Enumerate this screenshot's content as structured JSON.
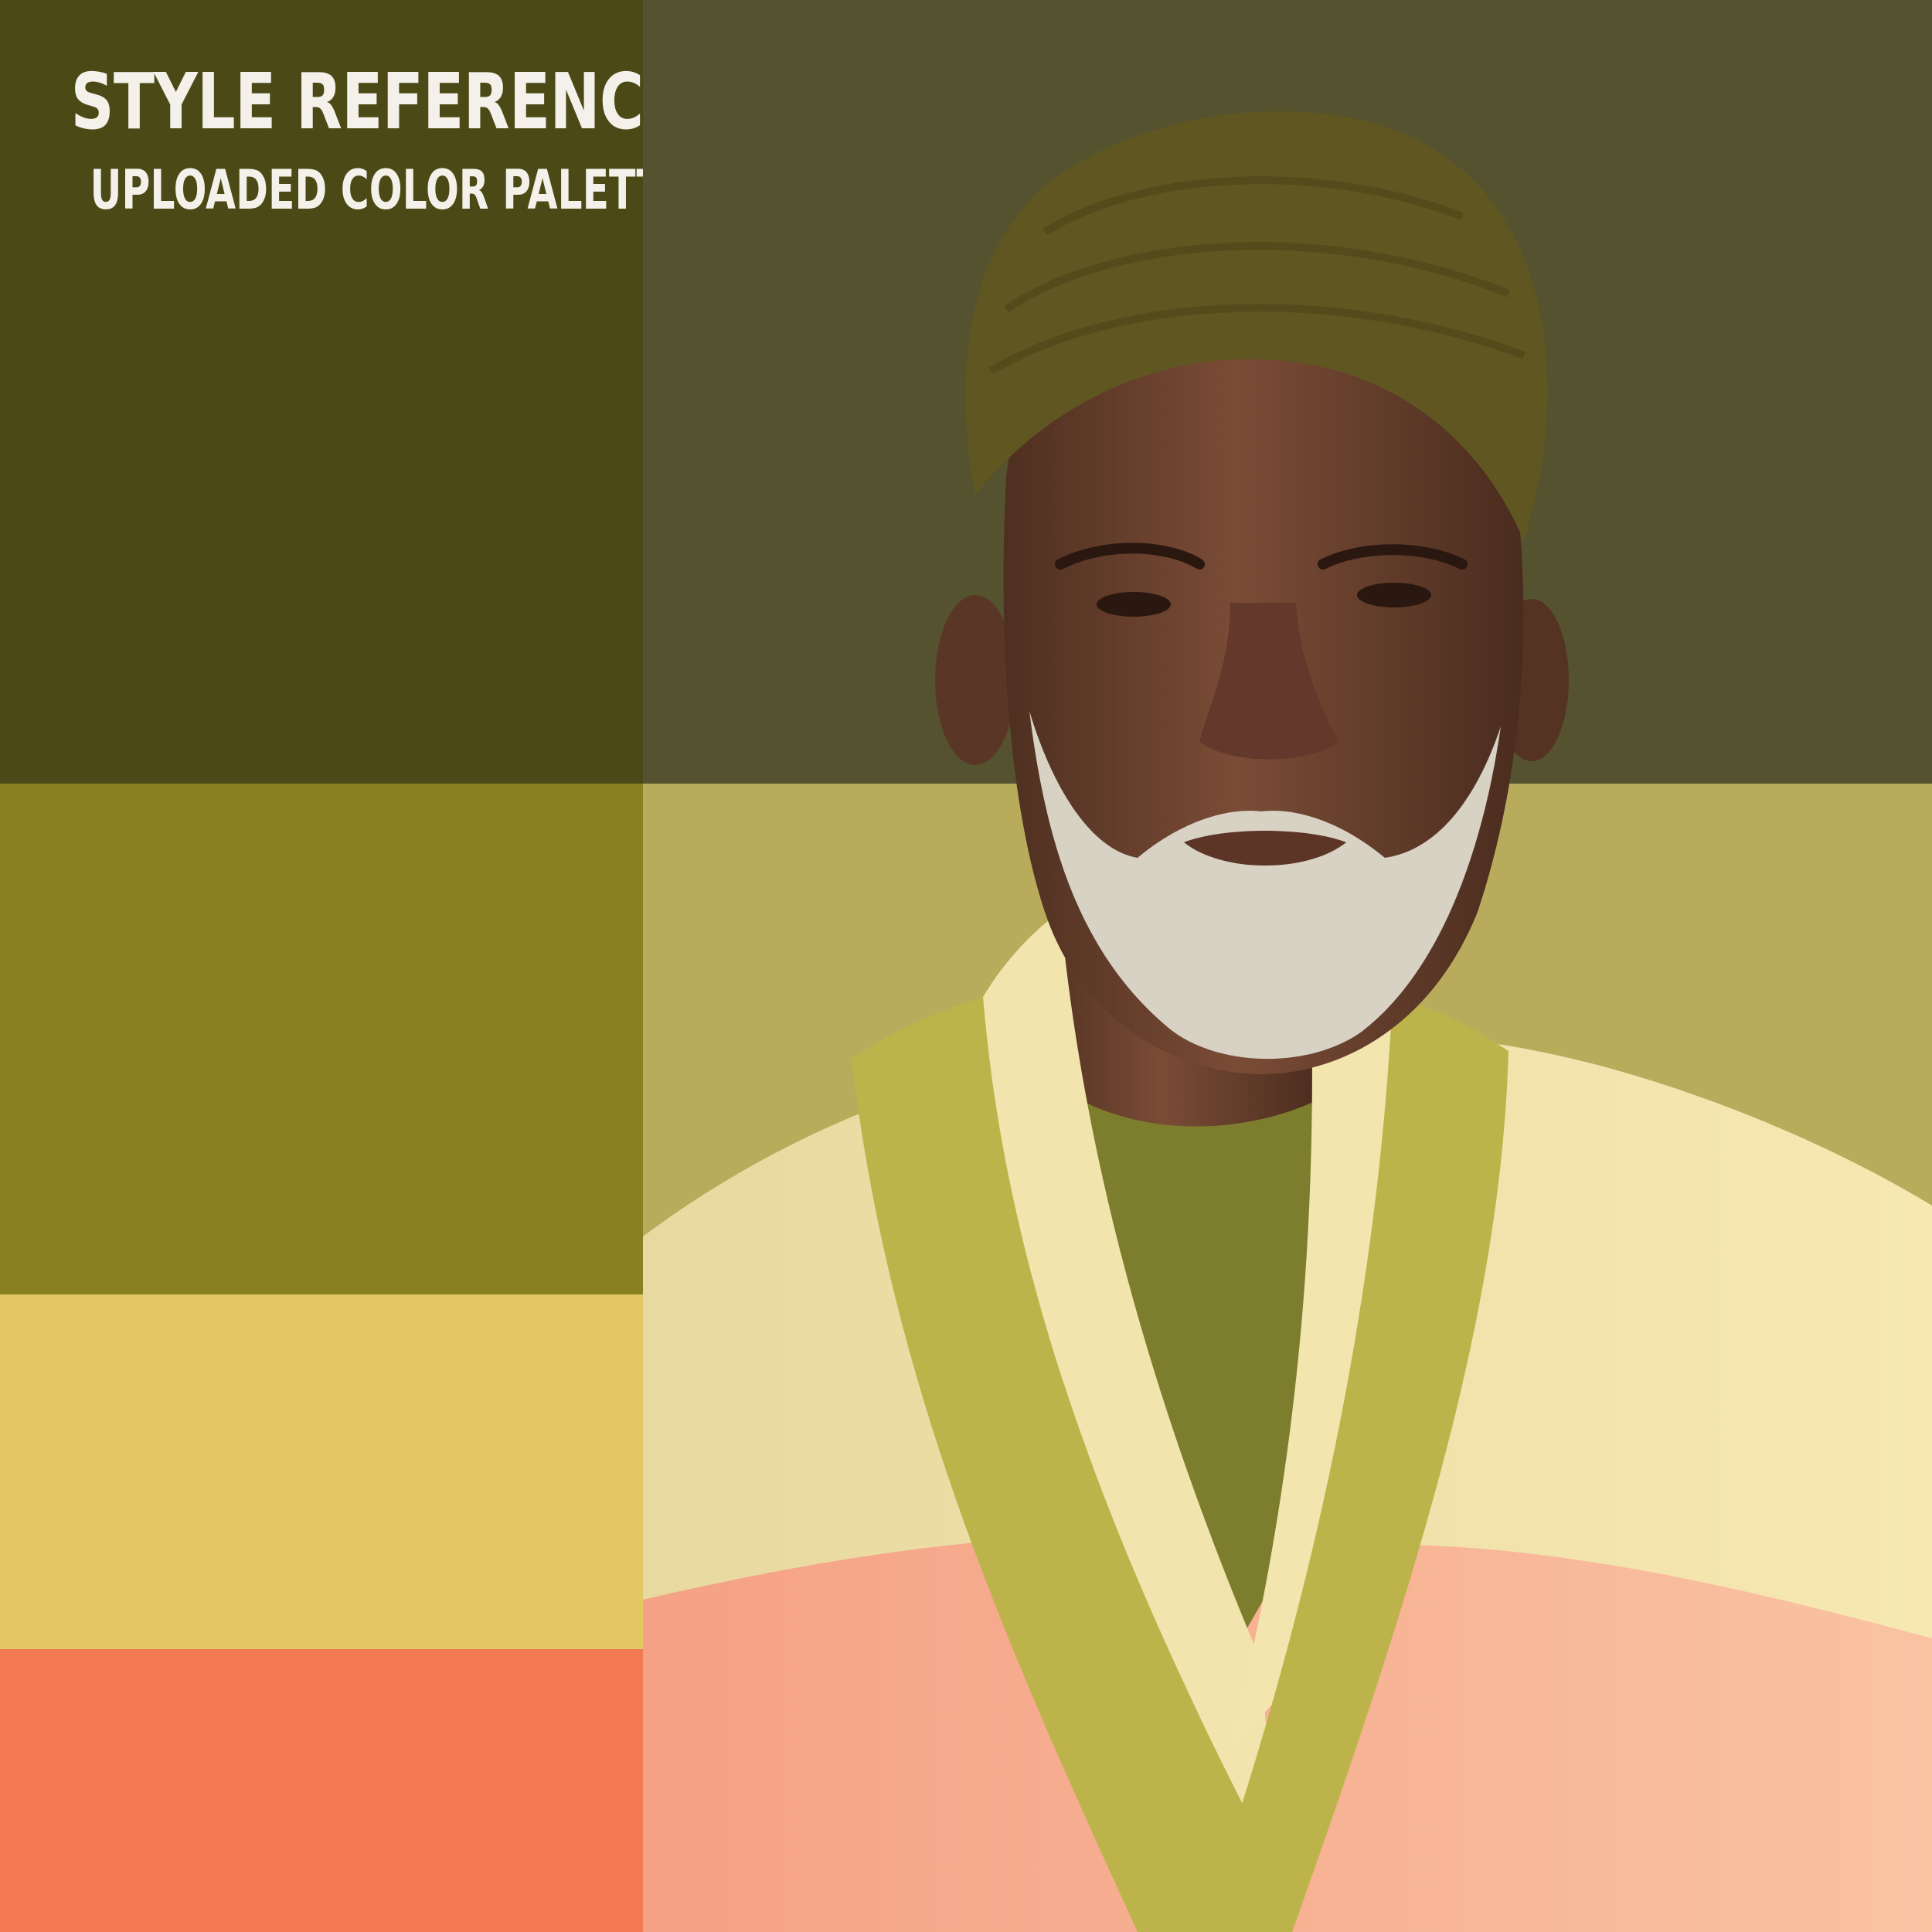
{
  "header": {
    "title": "STYLE REFERENCE:",
    "subtitle": "UPLOADED COLOR PALETTE"
  },
  "palette": {
    "colors": [
      "#4b4a16",
      "#8a8022",
      "#e3c864",
      "#f47a54"
    ]
  },
  "photo": {
    "subject": "portrait-of-man-in-olive-turban",
    "colors": {
      "background_top": "#55532f",
      "background_bottom": "#b8ac5c",
      "turban": "#5f5621",
      "skin": "#6e4632",
      "beard": "#d8d2c5",
      "robe_cream": "#efe1a3",
      "robe_green": "#bcb44b",
      "shirt": "#7d7d2e",
      "robe_peach": "#f7a98c"
    }
  }
}
